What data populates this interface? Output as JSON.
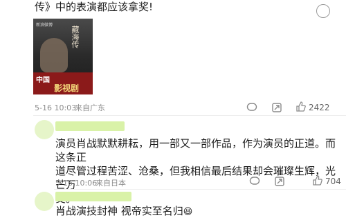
{
  "top_text": "传》中的表演都应该拿奖!",
  "poster": {
    "corner_logo": "新浪微博",
    "brand_title": "藏海传",
    "tag_left": "中国",
    "tag_main": "影视剧"
  },
  "comments": [
    {
      "time": "5-16 10:03",
      "location": "来自广东",
      "likes": "2422",
      "actions": [
        "comment-icon",
        "share-icon",
        "like-icon"
      ]
    },
    {
      "text_lines": [
        "演员肖战默默耕耘，用一部又一部作品，作为演员的正道。而这条正",
        "道尽管过程苦涩、沧桑，但我相信最后结果却会璀璨生辉，光芒万",
        "丈。"
      ],
      "time": "5-16 10:06",
      "location": "来自日本",
      "likes": "704"
    },
    {
      "text_lines": [
        "肖战演技封神 视帝实至名归"
      ],
      "emoji": "😆"
    }
  ],
  "colors": {
    "avatar_bg": "#e6f5c9",
    "name_bar": "#d9f2a8",
    "accent_red": "#c0392b"
  }
}
